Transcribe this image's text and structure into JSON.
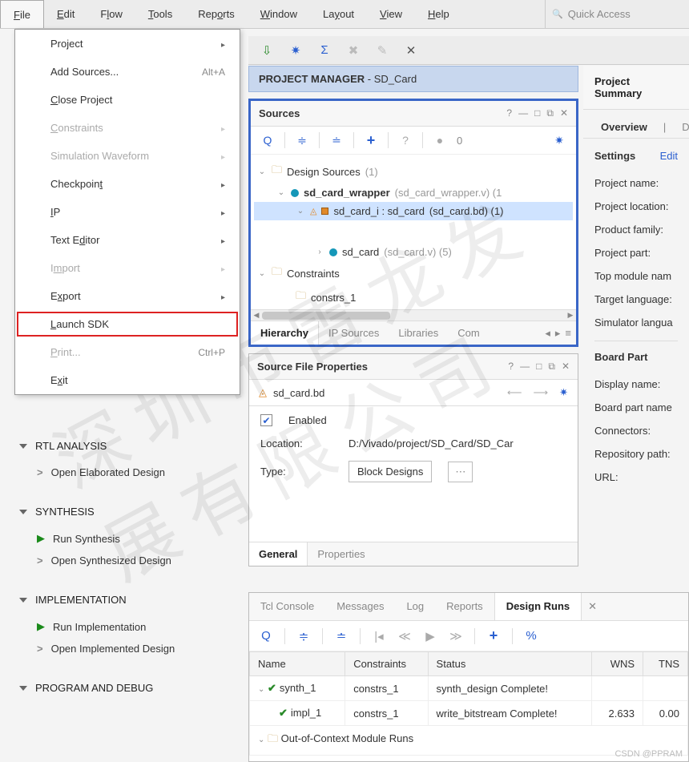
{
  "menubar": {
    "items": [
      "File",
      "Edit",
      "Flow",
      "Tools",
      "Reports",
      "Window",
      "Layout",
      "View",
      "Help"
    ],
    "quick_access_placeholder": "Quick Access"
  },
  "file_menu": {
    "items": [
      {
        "label": "Project",
        "submenu": true
      },
      {
        "label": "Add Sources...",
        "shortcut": "Alt+A"
      },
      {
        "label": "Close Project"
      },
      {
        "label": "Constraints",
        "submenu": true,
        "disabled": true
      },
      {
        "label": "Simulation Waveform",
        "submenu": true,
        "disabled": true
      },
      {
        "label": "Checkpoint",
        "submenu": true
      },
      {
        "label": "IP",
        "submenu": true
      },
      {
        "label": "Text Editor",
        "submenu": true
      },
      {
        "label": "Import",
        "submenu": true,
        "disabled": true
      },
      {
        "label": "Export",
        "submenu": true
      },
      {
        "label": "Launch SDK",
        "highlighted": true
      },
      {
        "label": "Print...",
        "shortcut": "Ctrl+P",
        "disabled": true
      },
      {
        "label": "Exit"
      }
    ]
  },
  "left_sections": [
    {
      "title": "RTL ANALYSIS",
      "items": [
        {
          "icon": "chev",
          "label": "Open Elaborated Design"
        }
      ]
    },
    {
      "title": "SYNTHESIS",
      "items": [
        {
          "icon": "play",
          "label": "Run Synthesis"
        },
        {
          "icon": "chev",
          "label": "Open Synthesized Design"
        }
      ]
    },
    {
      "title": "IMPLEMENTATION",
      "items": [
        {
          "icon": "play",
          "label": "Run Implementation"
        },
        {
          "icon": "chev",
          "label": "Open Implemented Design"
        }
      ]
    },
    {
      "title": "PROGRAM AND DEBUG",
      "items": []
    }
  ],
  "project_manager": {
    "title": "PROJECT MANAGER",
    "suffix": " - SD_Card"
  },
  "sources": {
    "title": "Sources",
    "count_badge": "0",
    "tree": {
      "design_sources": {
        "label": "Design Sources",
        "count": "(1)"
      },
      "wrapper": {
        "name": "sd_card_wrapper",
        "detail": "(sd_card_wrapper.v) (1"
      },
      "inst": {
        "name": "sd_card_i : sd_card",
        "detail": "(sd_card.bd) (1)"
      },
      "leaf": {
        "name": "sd_card",
        "detail": "(sd_card.v) (5)"
      },
      "constraints": {
        "label": "Constraints"
      },
      "constrs1": {
        "label": "constrs_1"
      }
    },
    "tabs": [
      "Hierarchy",
      "IP Sources",
      "Libraries",
      "Com"
    ]
  },
  "props": {
    "title": "Source File Properties",
    "file": "sd_card.bd",
    "enabled_label": "Enabled",
    "location_label": "Location:",
    "location_val": "D:/Vivado/project/SD_Card/SD_Car",
    "type_label": "Type:",
    "type_val": "Block Designs",
    "tabs": [
      "General",
      "Properties"
    ]
  },
  "summary": {
    "title": "Project Summary",
    "overview": "Overview",
    "das": "Das",
    "settings": "Settings",
    "edit": "Edit",
    "lines": [
      "Project name:",
      "Project location:",
      "Product family:",
      "Project part:",
      "Top module nam",
      "Target language:",
      "Simulator langua"
    ],
    "board_part": "Board Part",
    "board_lines": [
      "Display name:",
      "Board part name",
      "Connectors:",
      "Repository path:",
      "URL:"
    ]
  },
  "runs": {
    "tabs": [
      "Tcl Console",
      "Messages",
      "Log",
      "Reports",
      "Design Runs"
    ],
    "active_tab": 4,
    "cols": [
      "Name",
      "Constraints",
      "Status",
      "WNS",
      "TNS"
    ],
    "rows": [
      {
        "name": "synth_1",
        "indent": 0,
        "constraints": "constrs_1",
        "status": "synth_design Complete!",
        "wns": "",
        "tns": ""
      },
      {
        "name": "impl_1",
        "indent": 1,
        "constraints": "constrs_1",
        "status": "write_bitstream Complete!",
        "wns": "2.633",
        "tns": "0.00"
      }
    ],
    "ooc": "Out-of-Context Module Runs"
  },
  "csdn": "CSDN @PPRAM"
}
